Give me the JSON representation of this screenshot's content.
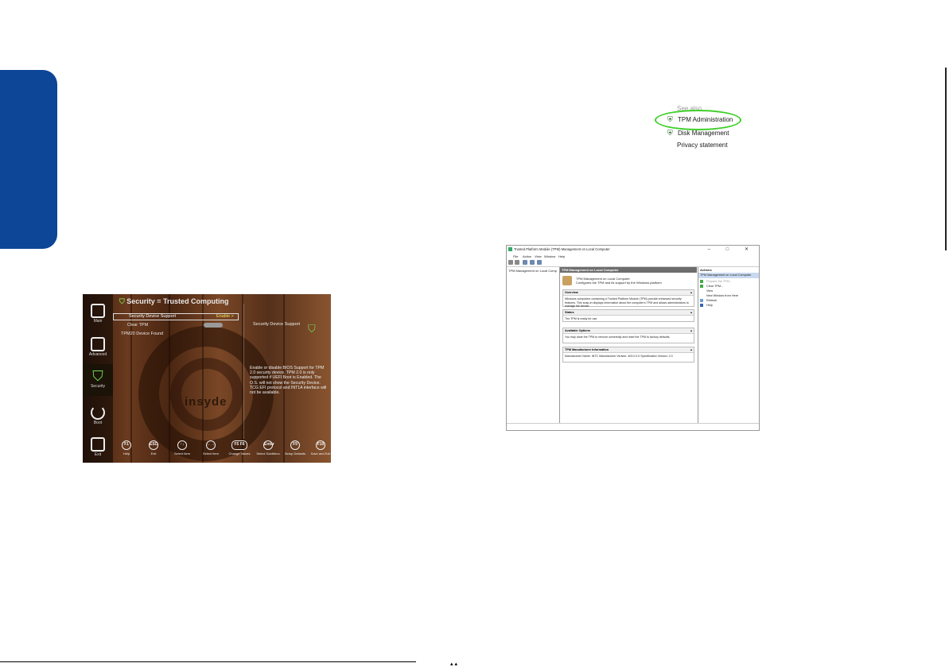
{
  "bios": {
    "title": "Security = Trusted Computing",
    "nav": [
      "Main",
      "Advanced",
      "Security",
      "Boot",
      "Exit"
    ],
    "options": {
      "device_support_label": "Security Device Support",
      "device_support_value": "Enable >",
      "clear_tpm_label": "Clear TPM",
      "tpm_found": "TPM20 Device Found"
    },
    "help": {
      "title": "Security Device Support",
      "text": "Enable or disable BIOS Support for TPM 2.0 security device. TPM 2.0 is only supported if UEFI Boot is Enabled. The O.S. will not show the Security Device. TCG EFI protocol and INT1A interface will not be available."
    },
    "logo": "insyde",
    "footer": [
      {
        "key": "F1",
        "label": "Help"
      },
      {
        "key": "ESC",
        "label": "Exit"
      },
      {
        "key": "↑↓",
        "label": "Select Item"
      },
      {
        "key": "←→",
        "label": "Select Item"
      },
      {
        "key": "F5 F6",
        "label": "Change Values"
      },
      {
        "key": "Enter",
        "label": "Select SubMenu"
      },
      {
        "key": "F9",
        "label": "Setup Defaults"
      },
      {
        "key": "F10",
        "label": "Save and Exit"
      }
    ]
  },
  "control_panel": {
    "see_also": "See also",
    "links": [
      "TPM Administration",
      "Disk Management",
      "Privacy statement"
    ]
  },
  "tpm_window": {
    "title": "Trusted Platform Module (TPM) Management on Local Computer",
    "window_buttons": "– □ ✕",
    "menu": [
      "File",
      "Action",
      "View",
      "Window",
      "Help"
    ],
    "tree_item": "TPM Management on Local Comp",
    "main_header": "TPM Management on Local Computer",
    "main_desc_1": "TPM Management on Local Computer",
    "main_desc_2": "Configures the TPM and its support by the Windows platform",
    "sections": [
      {
        "title": "Overview",
        "body": "Windows computers containing a Trusted Platform Module (TPM) provide enhanced security features. This snap-in displays information about the computer's TPM and allows administrators to manage the device."
      },
      {
        "title": "Status",
        "body": "The TPM is ready for use."
      },
      {
        "title": "Available Options",
        "body": "You may clear the TPM to remove ownership and reset the TPM to factory defaults."
      },
      {
        "title": "TPM Manufacturer Information",
        "body": "Manufacturer Name: INTC     Manufacturer Version: 403.0.0.0     Specification Version: 2.0"
      }
    ],
    "actions_header": "Actions",
    "actions_selected": "TPM Management on Local Computer",
    "actions": [
      "Prepare the TPM...",
      "Clear TPM...",
      "View",
      "New Window from Here",
      "Refresh",
      "Help"
    ]
  }
}
